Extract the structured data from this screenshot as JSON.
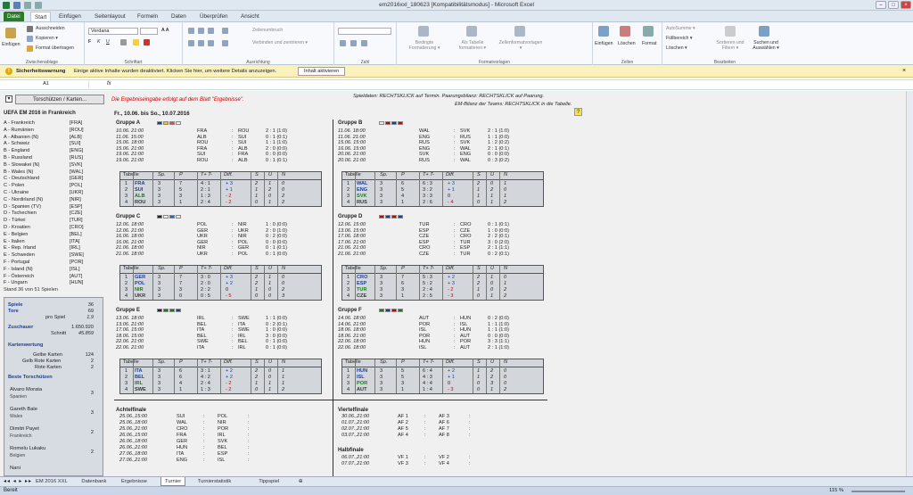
{
  "window": {
    "title": "em2016xxl_180623  [Kompatibilitätsmodus]  -  Microsoft Excel"
  },
  "tabs": [
    "Datei",
    "Start",
    "Einfügen",
    "Seitenlayout",
    "Formeln",
    "Daten",
    "Überprüfen",
    "Ansicht"
  ],
  "ribbon": {
    "clipboard": {
      "label": "Zwischenablage",
      "paste": "Einfügen",
      "cut": "Ausschneiden",
      "copy": "Kopieren ▾",
      "format": "Format übertragen"
    },
    "font": {
      "label": "Schriftart",
      "font_name": "Verdana",
      "font_size": ""
    },
    "align": {
      "label": "Ausrichtung",
      "wrap": "Zeilenumbruch",
      "merge": "Verbinden und zentrieren ▾"
    },
    "number": {
      "label": "Zahl"
    },
    "styles": {
      "label": "Formatvorlagen",
      "cond": "Bedingte Formatierung ▾",
      "astable": "Als Tabelle formatieren ▾",
      "cellstyles": "Zellenformatvorlagen ▾"
    },
    "cells": {
      "label": "Zellen",
      "insert": "Einfügen",
      "delete": "Löschen",
      "format": "Format"
    },
    "edit": {
      "label": "Bearbeiten",
      "autosum": "AutoSumme ▾",
      "fill": "Füllbereich ▾",
      "clear": "Löschen ▾",
      "sort": "Sortieren und Filtern ▾",
      "find": "Suchen und Auswählen ▾"
    }
  },
  "msgbar": {
    "title": "Sicherheitswarnung",
    "text": "Einige aktive Inhalte wurden deaktiviert. Klicken Sie hier, um weitere Details anzuzeigen.",
    "button": "Inhalt aktivieren"
  },
  "formula": {
    "cell": "A1",
    "fx": "fx",
    "value": ""
  },
  "sheet": {
    "nav_button": "Torschützen / Karten...",
    "notice": "Die Ergebniseingabe erfolgt auf dem Blatt \"Ergebnisse\".",
    "hint1": "Spieldaten: RECHTSKLICK auf Termin.   Paarungsbilanz: RECHTSKLICK auf Paarung.",
    "hint2": "EM-Bilanz der Teams: RECHTSKLICK in die Tabelle.",
    "hint_icon": "?",
    "left_title": "UEFA EM 2016 in Frankreich",
    "period": "Fr., 10.06. bis So., 10.07.2016",
    "teams": [
      [
        "A - Frankreich",
        "[FRA]"
      ],
      [
        "A - Rumänien",
        "[ROU]"
      ],
      [
        "A - Albanien  (N)",
        "[ALB]"
      ],
      [
        "A - Schweiz",
        "[SUI]"
      ],
      [
        "B - England",
        "[ENG]"
      ],
      [
        "B - Russland",
        "[RUS]"
      ],
      [
        "B - Slowakei  (N)",
        "[SVK]"
      ],
      [
        "B - Wales  (N)",
        "[WAL]"
      ],
      [
        "C - Deutschland",
        "[GER]"
      ],
      [
        "C - Polen",
        "[POL]"
      ],
      [
        "C - Ukraine",
        "[UKR]"
      ],
      [
        "C - Nordirland  (N)",
        "[NIR]"
      ],
      [
        "D - Spanien  (TV)",
        "[ESP]"
      ],
      [
        "D - Tschechien",
        "[CZE]"
      ],
      [
        "D - Türkei",
        "[TUR]"
      ],
      [
        "D - Kroatien",
        "[CRO]"
      ],
      [
        "E - Belgien",
        "[BEL]"
      ],
      [
        "E - Italien",
        "[ITA]"
      ],
      [
        "E - Rep. Irland",
        "[IRL]"
      ],
      [
        "E - Schweden",
        "[SWE]"
      ],
      [
        "F - Portugal",
        "[POR]"
      ],
      [
        "F - Island  (N)",
        "[ISL]"
      ],
      [
        "F - Österreich",
        "[AUT]"
      ],
      [
        "F - Ungarn",
        "[HUN]"
      ]
    ],
    "stand": "Stand  36 von 51 Spielen",
    "stats": {
      "spiele_l": "Spiele",
      "spiele_v": "36",
      "tore_l": "Tore",
      "tore_v": "69",
      "prospiel_l": "pro Spiel",
      "prospiel_v": "1,9",
      "zusch_l": "Zuschauer",
      "zusch_v": "1.650.920",
      "schnitt_l": "Schnitt",
      "schnitt_v": "45.859",
      "karten_l": "Kartenwertung",
      "gelb_l": "Gelbe Karten",
      "gelb_v": "124",
      "gelbrot_l": "Gelb Rote Karten",
      "gelbrot_v": "2",
      "rot_l": "Rote Karten",
      "rot_v": "2",
      "best_l": "Beste Torschützen"
    },
    "scorers": [
      [
        "Alvaro Morata",
        "Spanien",
        "3"
      ],
      [
        "Gareth Bale",
        "Wales",
        "3"
      ],
      [
        "Dimitri Payet",
        "Frankreich",
        "2"
      ],
      [
        "Romelu Lukaku",
        "Belgien",
        "2"
      ],
      [
        "Nani",
        "",
        ""
      ]
    ],
    "groups": [
      {
        "name": "Gruppe A",
        "flags": [
          "#1f3a93",
          "#f1c40f",
          "#e74c3c",
          "#eee"
        ],
        "games": [
          [
            "10.06.  21:00",
            "FRA",
            "ROU",
            "2 : 1 (1:0)"
          ],
          [
            "11.06.  15:00",
            "ALB",
            "SUI",
            "0 : 1 (0:1)"
          ],
          [
            "15.06.  18:00",
            "ROU",
            "SUI",
            "1 : 1 (1:0)"
          ],
          [
            "15.06.  21:00",
            "FRA",
            "ALB",
            "2 : 0 (0:0)"
          ],
          [
            "19.06.  21:00",
            "SUI",
            "FRA",
            "0 : 0 (0:0)"
          ],
          [
            "19.06.  21:00",
            "ROU",
            "ALB",
            "0 : 1 (0:1)"
          ]
        ],
        "table": [
          [
            "1",
            "FRA",
            "3",
            "7",
            "4 : 1",
            "+ 3",
            "2",
            "1",
            "0"
          ],
          [
            "2",
            "SUI",
            "3",
            "5",
            "2 : 1",
            "+ 1",
            "1",
            "2",
            "0"
          ],
          [
            "3",
            "ALB",
            "3",
            "3",
            "1 : 3",
            "- 2",
            "1",
            "0",
            "2"
          ],
          [
            "4",
            "ROU",
            "3",
            "1",
            "2 : 4",
            "- 2",
            "0",
            "1",
            "2"
          ]
        ]
      },
      {
        "name": "Gruppe B",
        "flags": [
          "#eee",
          "#c00",
          "#1a3ea0",
          "#c00"
        ],
        "games": [
          [
            "11.06.  18:00",
            "WAL",
            "SVK",
            "2 : 1 (1:0)"
          ],
          [
            "11.06.  21:00",
            "ENG",
            "RUS",
            "1 : 1 (0:0)"
          ],
          [
            "15.06.  15:00",
            "RUS",
            "SVK",
            "1 : 2 (0:2)"
          ],
          [
            "16.06.  15:00",
            "ENG",
            "WAL",
            "2 : 1 (0:1)"
          ],
          [
            "20.06.  21:00",
            "SVK",
            "ENG",
            "0 : 0 (0:0)"
          ],
          [
            "20.06.  21:00",
            "RUS",
            "WAL",
            "0 : 3 (0:2)"
          ]
        ],
        "table": [
          [
            "1",
            "WAL",
            "3",
            "6",
            "6 : 3",
            "+ 3",
            "2",
            "0",
            "1"
          ],
          [
            "2",
            "ENG",
            "3",
            "5",
            "3 : 2",
            "+ 1",
            "1",
            "2",
            "0"
          ],
          [
            "3",
            "SVK",
            "3",
            "4",
            "3 : 3",
            "0",
            "1",
            "1",
            "1"
          ],
          [
            "4",
            "RUS",
            "3",
            "1",
            "2 : 6",
            "- 4",
            "0",
            "1",
            "2"
          ]
        ]
      },
      {
        "name": "Gruppe C",
        "flags": [
          "#222",
          "#eee",
          "#1a6acc",
          "#eee"
        ],
        "games": [
          [
            "12.06.  18:00",
            "POL",
            "NIR",
            "1 : 0 (0:0)"
          ],
          [
            "12.06.  21:00",
            "GER",
            "UKR",
            "2 : 0 (1:0)"
          ],
          [
            "16.06.  18:00",
            "UKR",
            "NIR",
            "0 : 2 (0:0)"
          ],
          [
            "16.06.  21:00",
            "GER",
            "POL",
            "0 : 0 (0:0)"
          ],
          [
            "21.06.  18:00",
            "NIR",
            "GER",
            "0 : 1 (0:1)"
          ],
          [
            "21.06.  18:00",
            "UKR",
            "POL",
            "0 : 1 (0:0)"
          ]
        ],
        "table": [
          [
            "1",
            "GER",
            "3",
            "7",
            "3 : 0",
            "+ 3",
            "2",
            "1",
            "0"
          ],
          [
            "2",
            "POL",
            "3",
            "7",
            "2 : 0",
            "+ 2",
            "2",
            "1",
            "0"
          ],
          [
            "3",
            "NIR",
            "3",
            "3",
            "2 : 2",
            "0",
            "1",
            "0",
            "2"
          ],
          [
            "4",
            "UKR",
            "3",
            "0",
            "0 : 5",
            "- 5",
            "0",
            "0",
            "3"
          ]
        ]
      },
      {
        "name": "Gruppe D",
        "flags": [
          "#c00",
          "#1a3ea0",
          "#c00",
          "#1a3ea0"
        ],
        "games": [
          [
            "12.06.  15:00",
            "TUR",
            "CRO",
            "0 : 1 (0:1)"
          ],
          [
            "13.06.  15:00",
            "ESP",
            "CZE",
            "1 : 0 (0:0)"
          ],
          [
            "17.06.  18:00",
            "CZE",
            "CRO",
            "2 : 2 (0:1)"
          ],
          [
            "17.06.  21:00",
            "ESP",
            "TUR",
            "3 : 0 (2:0)"
          ],
          [
            "21.06.  21:00",
            "CRO",
            "ESP",
            "2 : 1 (1:1)"
          ],
          [
            "21.06.  21:00",
            "CZE",
            "TUR",
            "0 : 2 (0:1)"
          ]
        ],
        "table": [
          [
            "1",
            "CRO",
            "3",
            "7",
            "5 : 3",
            "+ 2",
            "2",
            "1",
            "0"
          ],
          [
            "2",
            "ESP",
            "3",
            "6",
            "5 : 2",
            "+ 3",
            "2",
            "0",
            "1"
          ],
          [
            "3",
            "TUR",
            "3",
            "3",
            "2 : 4",
            "- 2",
            "1",
            "0",
            "2"
          ],
          [
            "4",
            "CZE",
            "3",
            "1",
            "2 : 5",
            "- 3",
            "0",
            "1",
            "2"
          ]
        ]
      },
      {
        "name": "Gruppe E",
        "flags": [
          "#222",
          "#1a7a1a",
          "#1a7a1a",
          "#1a3ea0"
        ],
        "games": [
          [
            "13.06.  18:00",
            "IRL",
            "SWE",
            "1 : 1 (0:0)"
          ],
          [
            "13.06.  21:00",
            "BEL",
            "ITA",
            "0 : 2 (0:1)"
          ],
          [
            "17.06.  15:00",
            "ITA",
            "SWE",
            "1 : 0 (0:0)"
          ],
          [
            "18.06.  15:00",
            "BEL",
            "IRL",
            "3 : 0 (0:0)"
          ],
          [
            "22.06.  21:00",
            "SWE",
            "BEL",
            "0 : 1 (0:0)"
          ],
          [
            "22.06.  21:00",
            "ITA",
            "IRL",
            "0 : 1 (0:0)"
          ]
        ],
        "table": [
          [
            "1",
            "ITA",
            "3",
            "6",
            "3 : 1",
            "+ 2",
            "2",
            "0",
            "1"
          ],
          [
            "2",
            "BEL",
            "3",
            "6",
            "4 : 2",
            "+ 2",
            "2",
            "0",
            "1"
          ],
          [
            "3",
            "IRL",
            "3",
            "4",
            "2 : 4",
            "- 2",
            "1",
            "1",
            "1"
          ],
          [
            "4",
            "SWE",
            "3",
            "1",
            "1 : 3",
            "- 2",
            "0",
            "1",
            "2"
          ]
        ]
      },
      {
        "name": "Gruppe F",
        "flags": [
          "#1a7a1a",
          "#1a3ea0",
          "#c00",
          "#1a7a1a"
        ],
        "games": [
          [
            "14.06.  18:00",
            "AUT",
            "HUN",
            "0 : 2 (0:0)"
          ],
          [
            "14.06.  21:00",
            "POR",
            "ISL",
            "1 : 1 (1:0)"
          ],
          [
            "18.06.  18:00",
            "ISL",
            "HUN",
            "1 : 1 (1:0)"
          ],
          [
            "18.06.  21:00",
            "POR",
            "AUT",
            "0 : 0 (0:0)"
          ],
          [
            "22.06.  18:00",
            "HUN",
            "POR",
            "3 : 3 (1:1)"
          ],
          [
            "22.06.  18:00",
            "ISL",
            "AUT",
            "2 : 1 (1:0)"
          ]
        ],
        "table": [
          [
            "1",
            "HUN",
            "3",
            "5",
            "6 : 4",
            "+ 2",
            "1",
            "2",
            "0"
          ],
          [
            "2",
            "ISL",
            "3",
            "5",
            "4 : 3",
            "+ 1",
            "1",
            "2",
            "0"
          ],
          [
            "3",
            "POR",
            "3",
            "3",
            "4 : 4",
            "0",
            "0",
            "3",
            "0"
          ],
          [
            "4",
            "AUT",
            "3",
            "1",
            "1 : 4",
            "- 3",
            "0",
            "1",
            "2"
          ]
        ]
      }
    ],
    "table_head": [
      "Tabelle",
      "Sp.",
      "P",
      "T+  T-",
      "Diff.",
      "S",
      "U",
      "N"
    ],
    "ko": {
      "af_title": "Achtelfinale",
      "af": [
        [
          "25.06.,15:00",
          "SUI",
          ":",
          "POL",
          ":"
        ],
        [
          "25.06.,18:00",
          "WAL",
          ":",
          "NIR",
          ":"
        ],
        [
          "25.06.,21:00",
          "CRO",
          ":",
          "POR",
          ":"
        ],
        [
          "26.06.,15:00",
          "FRA",
          ":",
          "IRL",
          ":"
        ],
        [
          "26.06.,18:00",
          "GER",
          ":",
          "SVK",
          ":"
        ],
        [
          "26.06.,21:00",
          "HUN",
          ":",
          "BEL",
          ":"
        ],
        [
          "27.06.,18:00",
          "ITA",
          ":",
          "ESP",
          ":"
        ],
        [
          "27.06.,21:00",
          "ENG",
          ":",
          "ISL",
          ":"
        ]
      ],
      "vf_title": "Viertelfinale",
      "vf": [
        [
          "30.06.,21:00",
          "AF 1",
          ":",
          "AF 3",
          ":"
        ],
        [
          "01.07.,21:00",
          "AF 2",
          ":",
          "AF 6",
          ":"
        ],
        [
          "02.07.,21:00",
          "AF 5",
          ":",
          "AF 7",
          ":"
        ],
        [
          "03.07.,21:00",
          "AF 4",
          ":",
          "AF 8",
          ":"
        ]
      ],
      "hf_title": "Halbfinale",
      "hf": [
        [
          "06.07.,21:00",
          "VF 1",
          ":",
          "VF 2",
          ":"
        ],
        [
          "07.07.,21:00",
          "VF 3",
          ":",
          "VF 4",
          ":"
        ]
      ]
    }
  },
  "sheet_tabs": [
    "EM 2016 XXL",
    "Datenbank",
    "Ergebnisse",
    "Turnier",
    "Turnierstatistik",
    "Tippspiel"
  ],
  "active_tab": "Turnier",
  "status": {
    "left": "Bereit",
    "zoom": "115 %"
  }
}
